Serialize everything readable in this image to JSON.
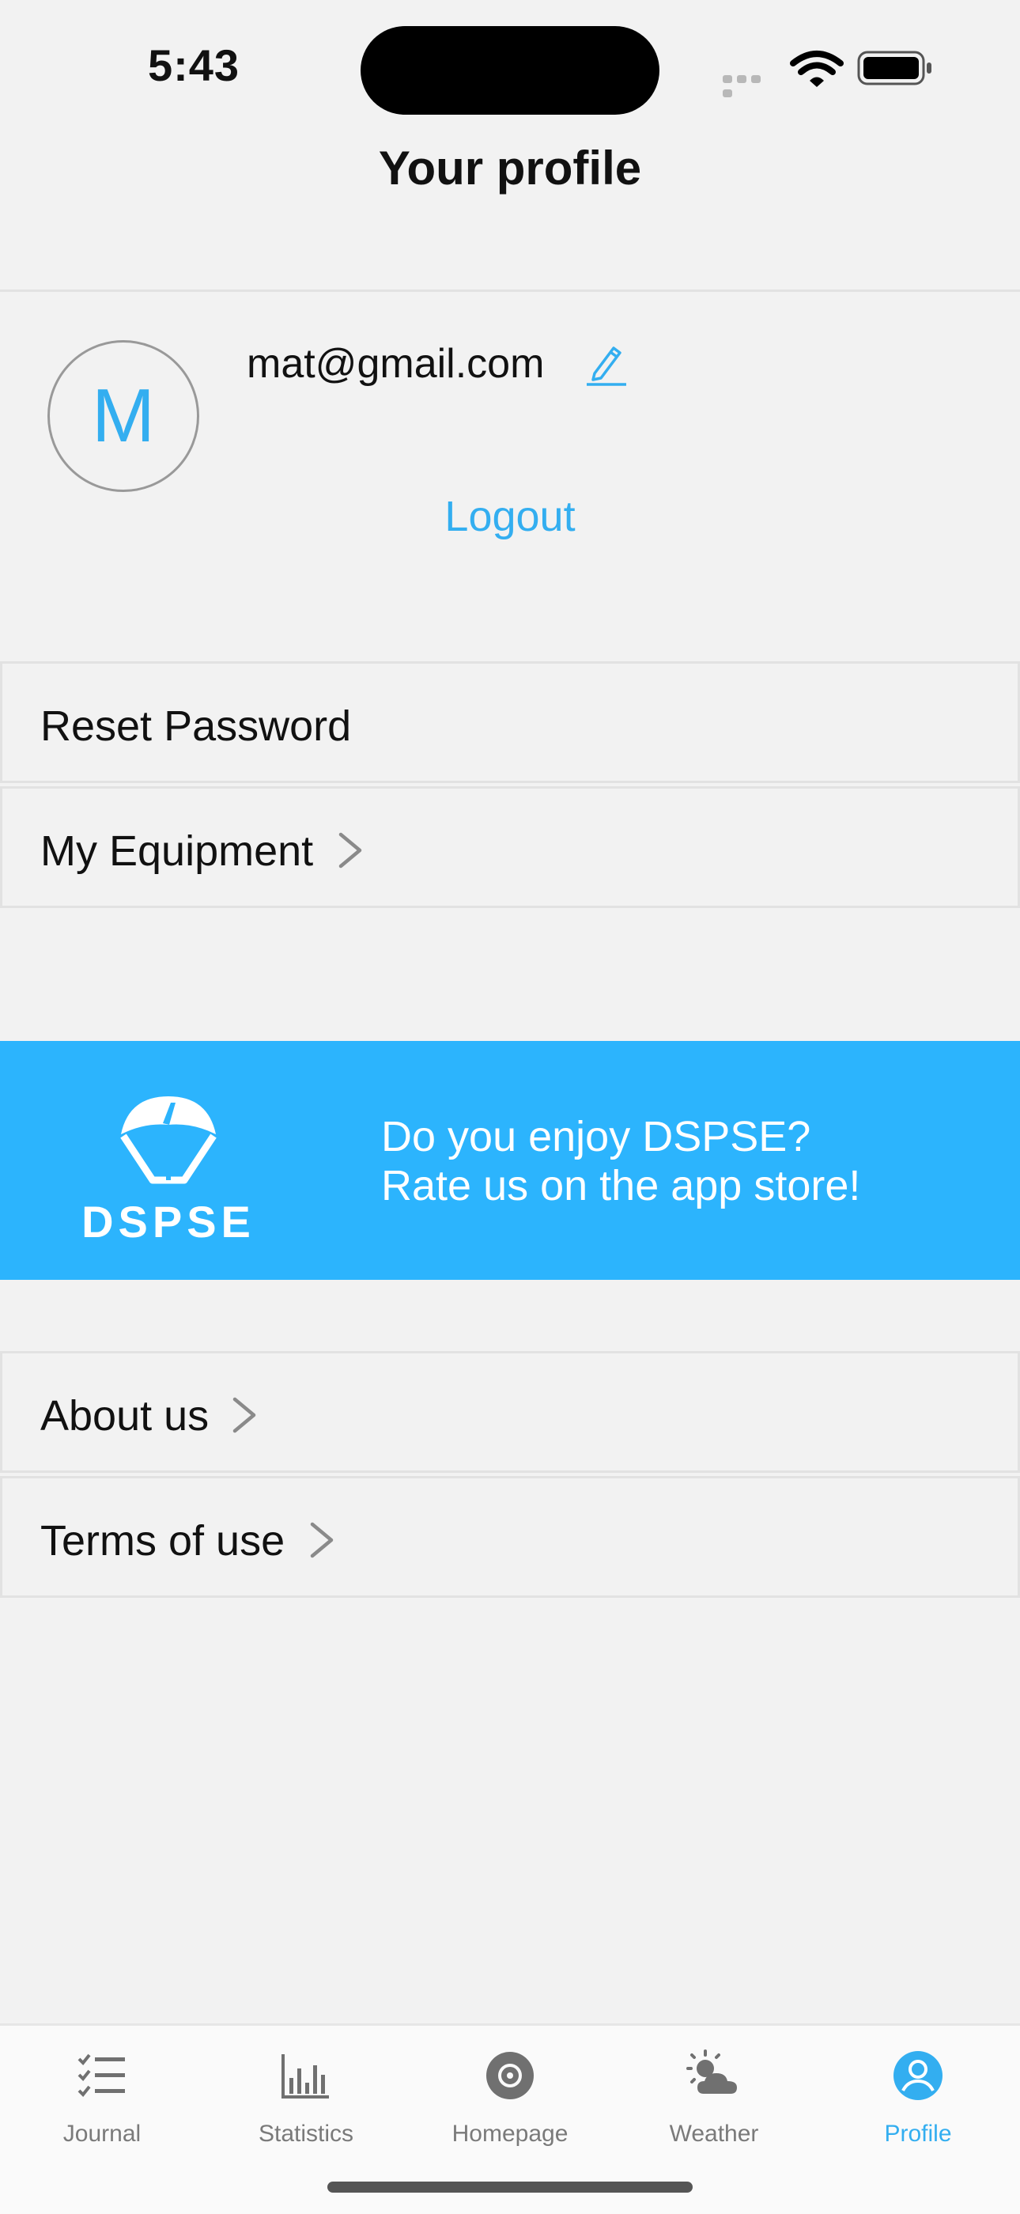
{
  "status_bar": {
    "time": "5:43"
  },
  "header": {
    "title": "Your profile"
  },
  "profile": {
    "avatar_initial": "M",
    "email": "mat@gmail.com",
    "logout_label": "Logout"
  },
  "menu_top": [
    {
      "label": "Reset Password"
    },
    {
      "label": "My Equipment"
    }
  ],
  "banner": {
    "logo_text": "DSPSE",
    "line1": "Do you enjoy DSPSE?",
    "line2": "Rate us on the app store!"
  },
  "menu_bottom": [
    {
      "label": "About us"
    },
    {
      "label": "Terms of use"
    }
  ],
  "tabs": [
    {
      "label": "Journal",
      "icon": "checklist-icon"
    },
    {
      "label": "Statistics",
      "icon": "bar-chart-icon"
    },
    {
      "label": "Homepage",
      "icon": "target-icon"
    },
    {
      "label": "Weather",
      "icon": "sun-cloud-icon"
    },
    {
      "label": "Profile",
      "icon": "user-icon",
      "active": true
    }
  ],
  "colors": {
    "accent": "#33aef0",
    "banner": "#2cb4fd",
    "background": "#f2f2f2"
  }
}
